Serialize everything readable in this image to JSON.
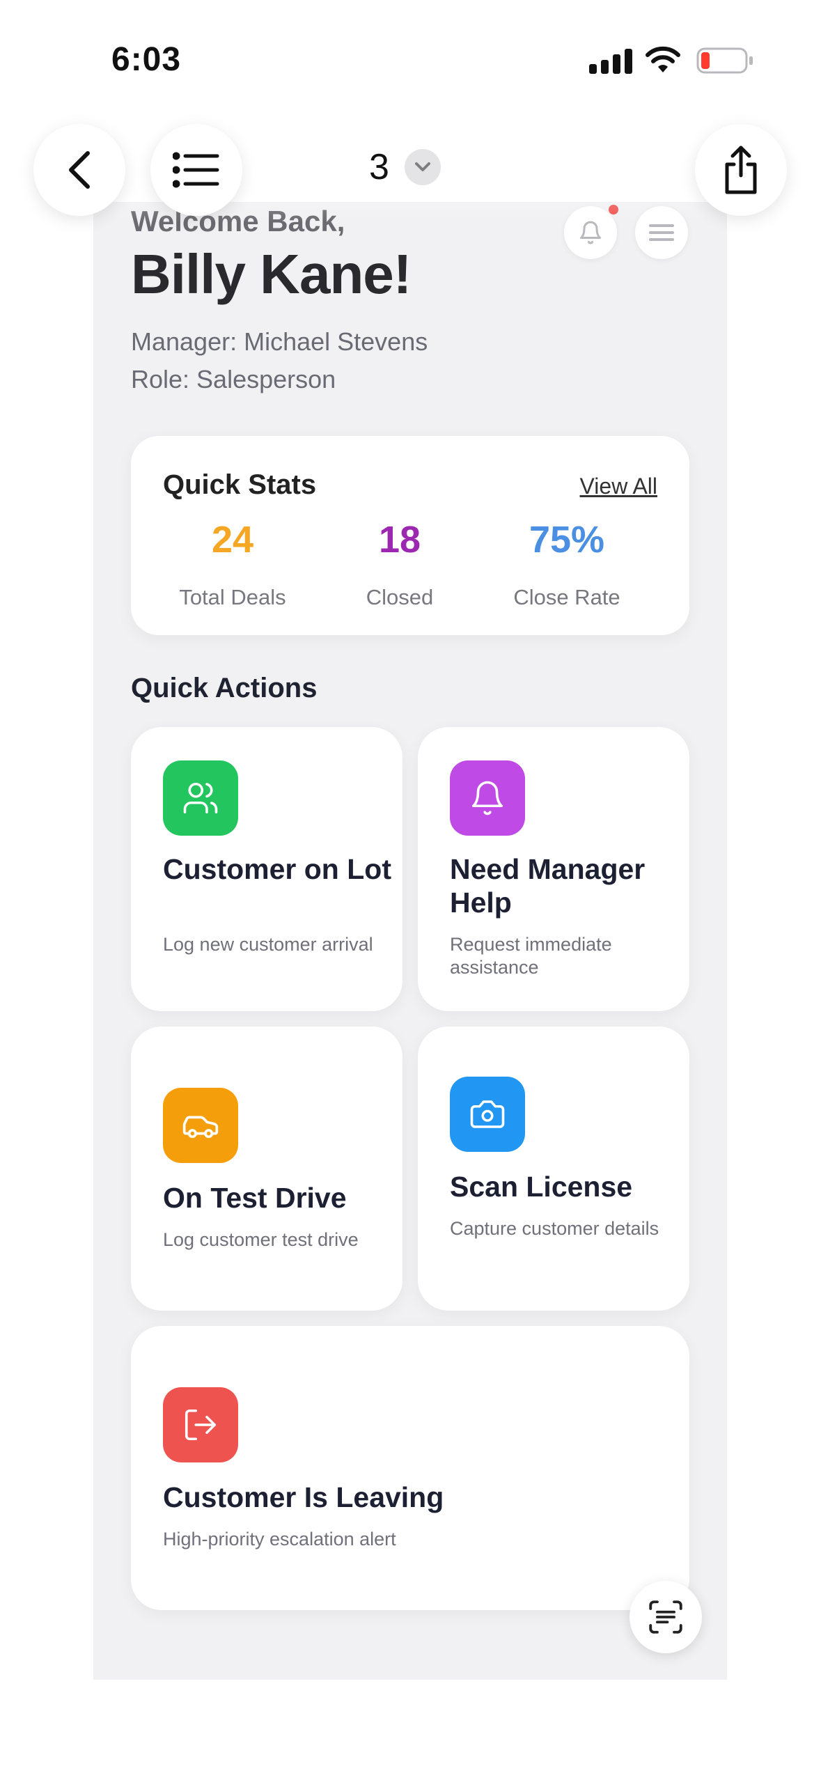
{
  "status_bar": {
    "time": "6:03"
  },
  "viewer": {
    "page_number": "3"
  },
  "header": {
    "welcome": "Welcome Back,",
    "name": "Billy Kane!",
    "manager": "Manager: Michael Stevens",
    "role": "Role: Salesperson"
  },
  "quick_stats": {
    "title": "Quick Stats",
    "view_all": "View All",
    "items": [
      {
        "value": "24",
        "label": "Total Deals",
        "color": "#f5a623"
      },
      {
        "value": "18",
        "label": "Closed",
        "color": "#9c27b0"
      },
      {
        "value": "75%",
        "label": "Close Rate",
        "color": "#4a8fe2"
      }
    ]
  },
  "quick_actions": {
    "title": "Quick Actions",
    "items": [
      {
        "title": "Customer on Lot",
        "desc": "Log new customer arrival",
        "icon": "users-icon",
        "color": "#22c55e"
      },
      {
        "title": "Need Manager Help",
        "desc": "Request immediate assistance",
        "icon": "bell-icon",
        "color": "#c04ae6"
      },
      {
        "title": "On Test Drive",
        "desc": "Log customer test drive",
        "icon": "car-icon",
        "color": "#f59e0b"
      },
      {
        "title": "Scan License",
        "desc": "Capture customer details",
        "icon": "camera-icon",
        "color": "#2196f3"
      },
      {
        "title": "Customer Is Leaving",
        "desc": "High-priority escalation alert",
        "icon": "exit-icon",
        "color": "#ef5350"
      }
    ]
  }
}
